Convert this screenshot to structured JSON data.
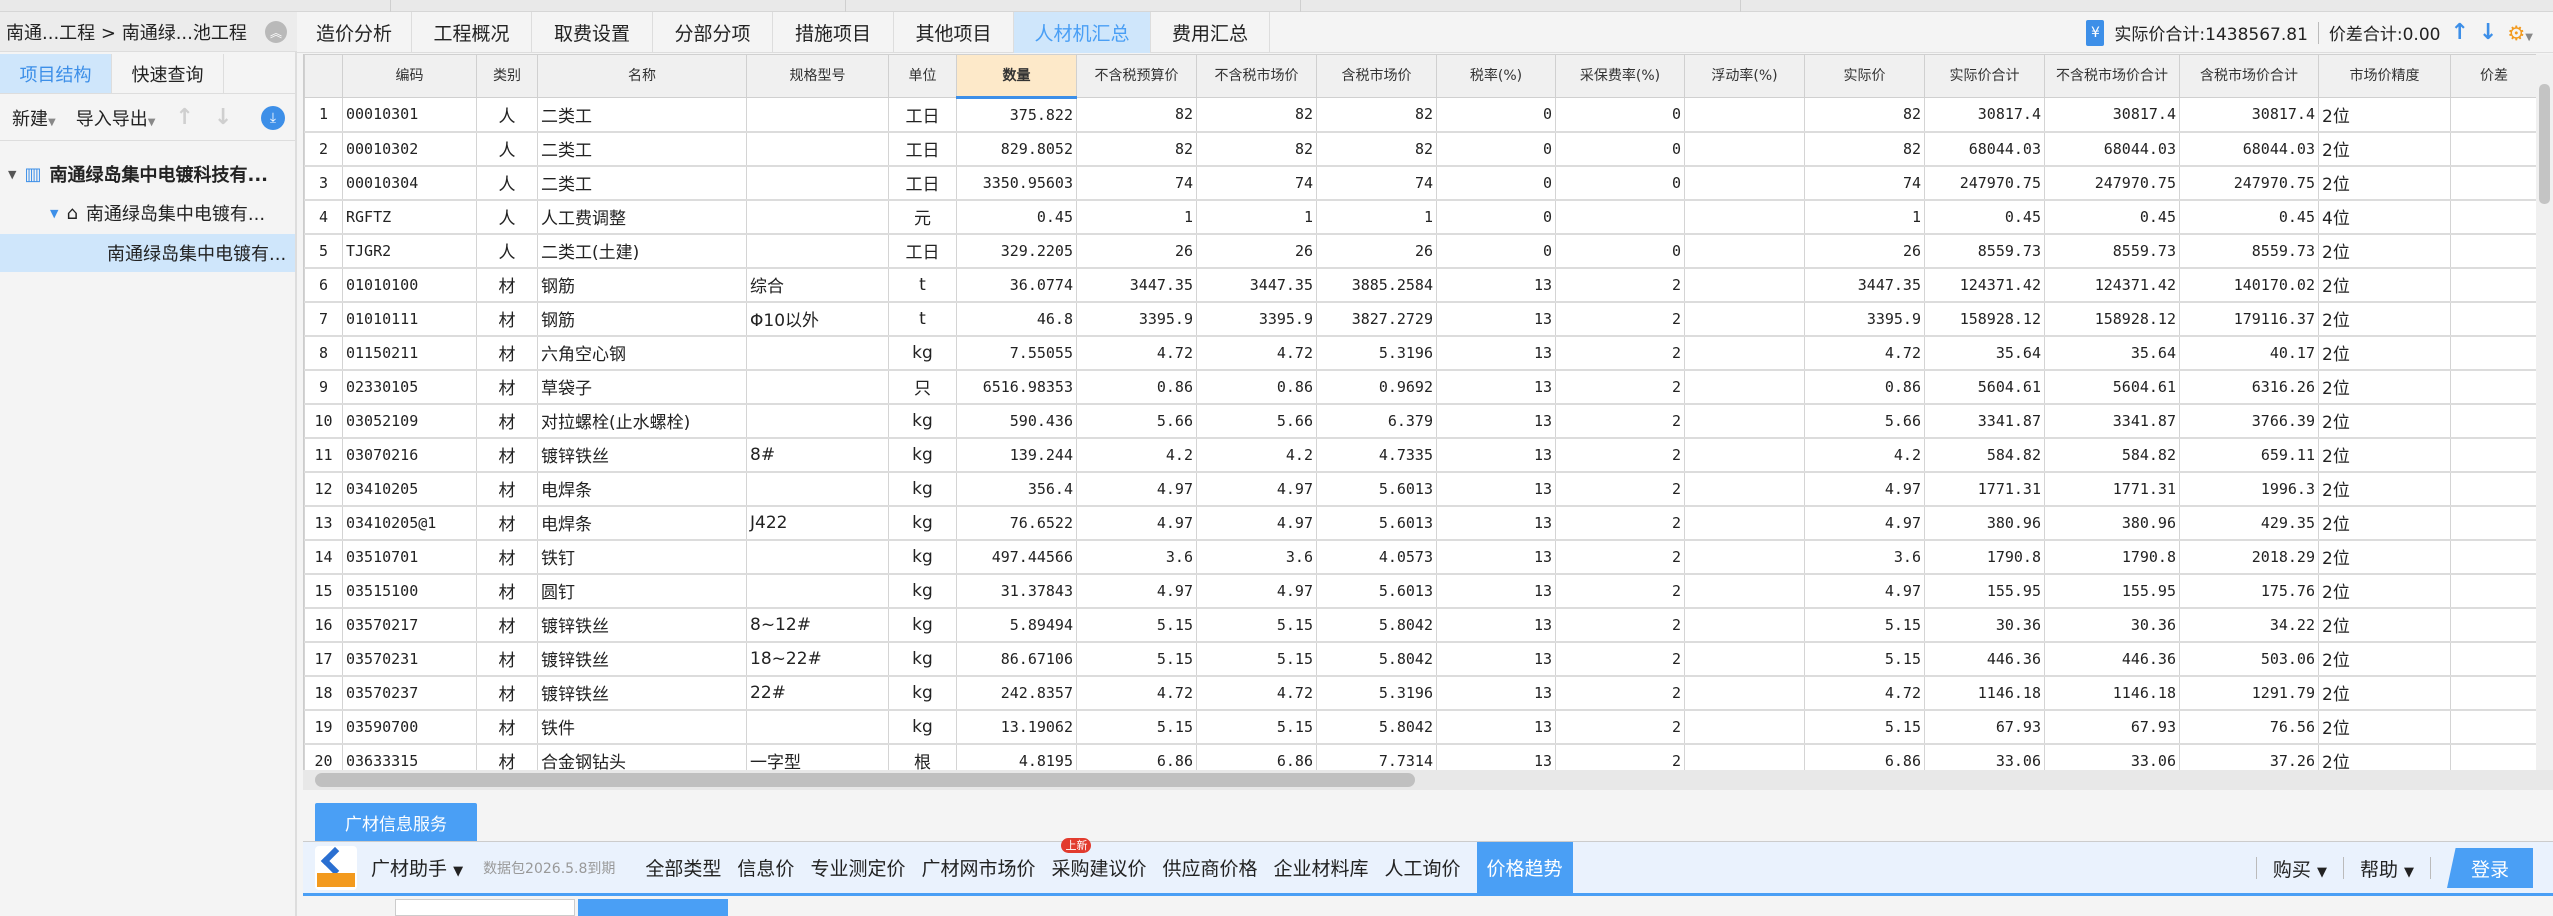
{
  "left": {
    "breadcrumb": "南通...工程 > 南通绿...池工程",
    "tabs": [
      "项目结构",
      "快速查询"
    ],
    "toolbar": {
      "new": "新建",
      "import_export": "导入导出"
    },
    "tree": [
      "南通绿岛集中电镀科技有...",
      "南通绿岛集中电镀有...",
      "南通绿岛集中电镀有..."
    ]
  },
  "tabs": [
    "造价分析",
    "工程概况",
    "取费设置",
    "分部分项",
    "措施项目",
    "其他项目",
    "人材机汇总",
    "费用汇总"
  ],
  "active_tab": "人材机汇总",
  "totals": {
    "actual": "实际价合计:1438567.81",
    "diff": "价差合计:0.00"
  },
  "columns": [
    "",
    "编码",
    "类别",
    "名称",
    "规格型号",
    "单位",
    "数量",
    "不含税预算价",
    "不含税市场价",
    "含税市场价",
    "税率(%)",
    "采保费率(%)",
    "浮动率(%)",
    "实际价",
    "实际价合计",
    "不含税市场价合计",
    "含税市场价合计",
    "市场价精度",
    "价差"
  ],
  "rows": [
    [
      "1",
      "00010301",
      "人",
      "二类工",
      "",
      "工日",
      "375.822",
      "82",
      "82",
      "82",
      "0",
      "0",
      "",
      "82",
      "30817.4",
      "30817.4",
      "30817.4",
      "2位",
      ""
    ],
    [
      "2",
      "00010302",
      "人",
      "二类工",
      "",
      "工日",
      "829.8052",
      "82",
      "82",
      "82",
      "0",
      "0",
      "",
      "82",
      "68044.03",
      "68044.03",
      "68044.03",
      "2位",
      ""
    ],
    [
      "3",
      "00010304",
      "人",
      "二类工",
      "",
      "工日",
      "3350.95603",
      "74",
      "74",
      "74",
      "0",
      "0",
      "",
      "74",
      "247970.75",
      "247970.75",
      "247970.75",
      "2位",
      ""
    ],
    [
      "4",
      "RGFTZ",
      "人",
      "人工费调整",
      "",
      "元",
      "0.45",
      "1",
      "1",
      "1",
      "0",
      "",
      "",
      "1",
      "0.45",
      "0.45",
      "0.45",
      "4位",
      ""
    ],
    [
      "5",
      "TJGR2",
      "人",
      "二类工(土建)",
      "",
      "工日",
      "329.2205",
      "26",
      "26",
      "26",
      "0",
      "0",
      "",
      "26",
      "8559.73",
      "8559.73",
      "8559.73",
      "2位",
      ""
    ],
    [
      "6",
      "01010100",
      "材",
      "钢筋",
      "综合",
      "t",
      "36.0774",
      "3447.35",
      "3447.35",
      "3885.2584",
      "13",
      "2",
      "",
      "3447.35",
      "124371.42",
      "124371.42",
      "140170.02",
      "2位",
      ""
    ],
    [
      "7",
      "01010111",
      "材",
      "钢筋",
      "Φ10以外",
      "t",
      "46.8",
      "3395.9",
      "3395.9",
      "3827.2729",
      "13",
      "2",
      "",
      "3395.9",
      "158928.12",
      "158928.12",
      "179116.37",
      "2位",
      ""
    ],
    [
      "8",
      "01150211",
      "材",
      "六角空心钢",
      "",
      "kg",
      "7.55055",
      "4.72",
      "4.72",
      "5.3196",
      "13",
      "2",
      "",
      "4.72",
      "35.64",
      "35.64",
      "40.17",
      "2位",
      ""
    ],
    [
      "9",
      "02330105",
      "材",
      "草袋子",
      "",
      "只",
      "6516.98353",
      "0.86",
      "0.86",
      "0.9692",
      "13",
      "2",
      "",
      "0.86",
      "5604.61",
      "5604.61",
      "6316.26",
      "2位",
      ""
    ],
    [
      "10",
      "03052109",
      "材",
      "对拉螺栓(止水螺栓)",
      "",
      "kg",
      "590.436",
      "5.66",
      "5.66",
      "6.379",
      "13",
      "2",
      "",
      "5.66",
      "3341.87",
      "3341.87",
      "3766.39",
      "2位",
      ""
    ],
    [
      "11",
      "03070216",
      "材",
      "镀锌铁丝",
      "8#",
      "kg",
      "139.244",
      "4.2",
      "4.2",
      "4.7335",
      "13",
      "2",
      "",
      "4.2",
      "584.82",
      "584.82",
      "659.11",
      "2位",
      ""
    ],
    [
      "12",
      "03410205",
      "材",
      "电焊条",
      "",
      "kg",
      "356.4",
      "4.97",
      "4.97",
      "5.6013",
      "13",
      "2",
      "",
      "4.97",
      "1771.31",
      "1771.31",
      "1996.3",
      "2位",
      ""
    ],
    [
      "13",
      "03410205@1",
      "材",
      "电焊条",
      "J422",
      "kg",
      "76.6522",
      "4.97",
      "4.97",
      "5.6013",
      "13",
      "2",
      "",
      "4.97",
      "380.96",
      "380.96",
      "429.35",
      "2位",
      ""
    ],
    [
      "14",
      "03510701",
      "材",
      "铁钉",
      "",
      "kg",
      "497.44566",
      "3.6",
      "3.6",
      "4.0573",
      "13",
      "2",
      "",
      "3.6",
      "1790.8",
      "1790.8",
      "2018.29",
      "2位",
      ""
    ],
    [
      "15",
      "03515100",
      "材",
      "圆钉",
      "",
      "kg",
      "31.37843",
      "4.97",
      "4.97",
      "5.6013",
      "13",
      "2",
      "",
      "4.97",
      "155.95",
      "155.95",
      "175.76",
      "2位",
      ""
    ],
    [
      "16",
      "03570217",
      "材",
      "镀锌铁丝",
      "8~12#",
      "kg",
      "5.89494",
      "5.15",
      "5.15",
      "5.8042",
      "13",
      "2",
      "",
      "5.15",
      "30.36",
      "30.36",
      "34.22",
      "2位",
      ""
    ],
    [
      "17",
      "03570231",
      "材",
      "镀锌铁丝",
      "18~22#",
      "kg",
      "86.67106",
      "5.15",
      "5.15",
      "5.8042",
      "13",
      "2",
      "",
      "5.15",
      "446.36",
      "446.36",
      "503.06",
      "2位",
      ""
    ],
    [
      "18",
      "03570237",
      "材",
      "镀锌铁丝",
      "22#",
      "kg",
      "242.8357",
      "4.72",
      "4.72",
      "5.3196",
      "13",
      "2",
      "",
      "4.72",
      "1146.18",
      "1146.18",
      "1291.79",
      "2位",
      ""
    ],
    [
      "19",
      "03590700",
      "材",
      "铁件",
      "",
      "kg",
      "13.19062",
      "5.15",
      "5.15",
      "5.8042",
      "13",
      "2",
      "",
      "5.15",
      "67.93",
      "67.93",
      "76.56",
      "2位",
      ""
    ],
    [
      "20",
      "03633315",
      "材",
      "合金钢钻头",
      "一字型",
      "根",
      "4.8195",
      "6.86",
      "6.86",
      "7.7314",
      "13",
      "2",
      "",
      "6.86",
      "33.06",
      "33.06",
      "37.26",
      "2位",
      ""
    ]
  ],
  "service": {
    "tab": "广材信息服务",
    "assistant": "广材助手",
    "package": "数据包2026.5.8到期",
    "menu": [
      "全部类型",
      "信息价",
      "专业测定价",
      "广材网市场价",
      "采购建议价",
      "供应商价格",
      "企业材料库",
      "人工询价",
      "价格趋势"
    ],
    "active": "价格趋势",
    "badge": "上新",
    "buy": "购买",
    "help": "帮助",
    "login": "登录"
  },
  "colors": {
    "accent": "#4a9ff5",
    "active_tab_bg": "#cfe6fb",
    "qty_header": "#fde9c9",
    "badge": "#e23b2e"
  }
}
